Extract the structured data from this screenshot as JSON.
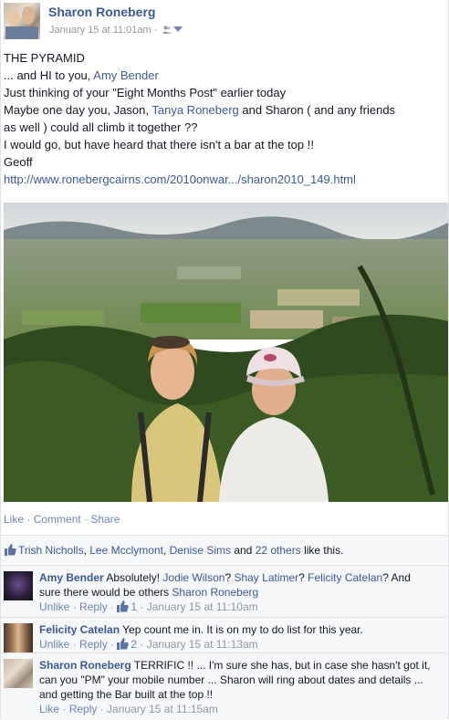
{
  "post": {
    "author": "Sharon Roneberg",
    "timestamp": "January 15 at 11:01am",
    "separator": " · ",
    "audience_icon": "friends-icon",
    "lines": {
      "l1": "THE PYRAMID",
      "l2_pre": "... and HI to you, ",
      "l2_link": "Amy Bender",
      "l3": "Just thinking of your \"Eight Months Post\" earlier today",
      "l4_pre": "Maybe one day you, Jason, ",
      "l4_link": "Tanya Roneberg",
      "l4_post": " and Sharon ( and any friends",
      "l5": "as well ) could all climb it together ??",
      "l6": "I would go, but have heard that there isn't a bar at the top !!",
      "l7": "Geoff",
      "url": "http://www.ronebergcairns.com/2010onwar.../sharon2010_149.html"
    }
  },
  "actions": {
    "like": "Like",
    "comment": "Comment",
    "share": "Share",
    "dot": " · "
  },
  "likes": {
    "name1": "Trish Nicholls",
    "name2": "Lee Mcclymont",
    "name3": "Denise Sims",
    "and": " and ",
    "others": "22 others",
    "suffix": " like this.",
    "comma": ", "
  },
  "comments": [
    {
      "name": "Amy Bender",
      "text_pre": " Absolutely! ",
      "m1": "Jodie Wilson",
      "q1": "? ",
      "m2": "Shay Latimer",
      "q2": "? ",
      "m3": "Felicity Catelan",
      "q3": "? And",
      "line2_pre": "sure there would be others ",
      "m4": "Sharon Roneberg",
      "unlike": "Unlike",
      "reply": "Reply",
      "like_count": "1",
      "time": "January 15 at 11:10am"
    },
    {
      "name": "Felicity Catelan",
      "text": " Yep count me in. It is on my to do list for this year.",
      "unlike": "Unlike",
      "reply": "Reply",
      "like_count": "2",
      "time": "January 15 at 11:13am"
    },
    {
      "name": "Sharon Roneberg",
      "text1": " TERRIFIC !! ... I'm sure she has, but in case she hasn't got it,",
      "text2": "can you \"PM\" your mobile number ... Sharon will ring about dates and details ...",
      "text3": "and getting the Bar built at the top !!",
      "like": "Like",
      "reply": "Reply",
      "time": "January 15 at 11:15am"
    }
  ],
  "colors": {
    "link": "#3b5998",
    "meta": "#9197a3",
    "comment_bg": "#f6f7f8"
  }
}
